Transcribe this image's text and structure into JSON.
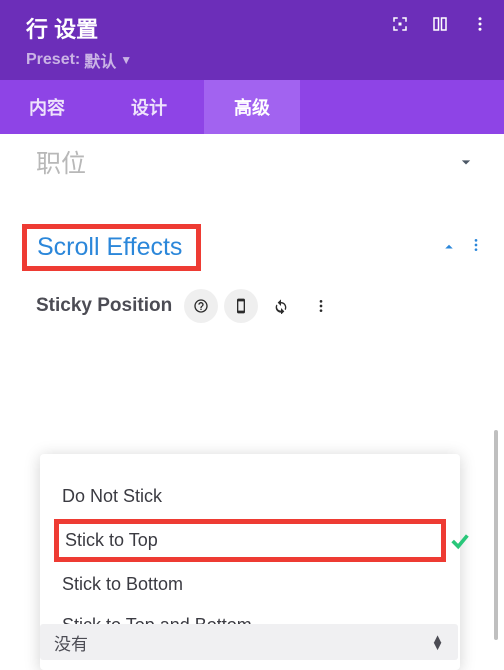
{
  "header": {
    "title": "行 设置",
    "preset_label": "Preset:",
    "preset_value": "默认"
  },
  "tabs": {
    "content": "内容",
    "design": "设计",
    "advanced": "高级"
  },
  "accordion": {
    "position_label": "职位"
  },
  "scroll": {
    "title": "Scroll Effects",
    "sticky_label": "Sticky Position"
  },
  "options": {
    "do_not_stick": "Do Not Stick",
    "stick_top": "Stick to Top",
    "stick_bottom": "Stick to Bottom",
    "stick_both": "Stick to Top and Bottom"
  },
  "bottom_select": {
    "value": "没有"
  }
}
